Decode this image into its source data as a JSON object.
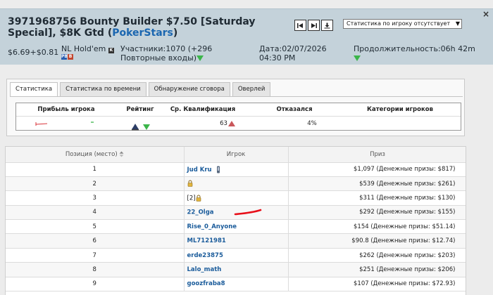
{
  "header": {
    "title_main": "3971968756 Bounty Builder $7.50 [Saturday Special], $8K Gtd (",
    "title_site": "PokerStars",
    "title_close": ")",
    "buyin": "$6.69+$0.81",
    "game": "NL Hold'em",
    "participants": "Участники:1070 (+296 Повторные входы)",
    "date": "Дата:02/07/2026 04:30 PM",
    "duration": "Продолжительность:06h 42m",
    "stats_select_value": "Статистика по игроку отсутствует",
    "close": "×"
  },
  "tabs": [
    {
      "label": "Статистика",
      "active": true
    },
    {
      "label": "Статистика по времени",
      "active": false
    },
    {
      "label": "Обнаружение сговора",
      "active": false
    },
    {
      "label": "Оверлей",
      "active": false
    }
  ],
  "summary": {
    "headers": [
      "Прибыль игрока",
      "Рейтинг",
      "Ср. Квалификация",
      "Отказался",
      "Категории игроков"
    ],
    "avg_qualification": "63",
    "refused": "4%"
  },
  "results": {
    "columns": [
      "Позиция (место)",
      "Игрок",
      "Приз"
    ],
    "rows": [
      {
        "pos": "1",
        "player": "Jud Kru",
        "prize": "$1,097  (Денежные призы: $817)"
      },
      {
        "pos": "2",
        "player": "",
        "prize": "$539  (Денежные призы: $261)"
      },
      {
        "pos": "3",
        "player": "[2]",
        "prize": "$311  (Денежные призы: $130)"
      },
      {
        "pos": "4",
        "player": "22_Olga",
        "prize": "$292  (Денежные призы: $155)"
      },
      {
        "pos": "5",
        "player": "Rise_0_Anyone",
        "prize": "$154  (Денежные призы: $51.14)"
      },
      {
        "pos": "6",
        "player": "ML7121981",
        "prize": "$90.8  (Денежные призы: $12.74)"
      },
      {
        "pos": "7",
        "player": "erde23875",
        "prize": "$262  (Денежные призы: $203)"
      },
      {
        "pos": "8",
        "player": "Lalo_math",
        "prize": "$251  (Денежные призы: $206)"
      },
      {
        "pos": "9",
        "player": "goozfraba8",
        "prize": "$107  (Денежные призы: $72.93)"
      }
    ]
  },
  "colors": {
    "link": "#1a66b0",
    "header_bg": "#c4d2da",
    "up": "#c9575b",
    "down": "#3bb54a",
    "annotation": "#e8101a"
  }
}
